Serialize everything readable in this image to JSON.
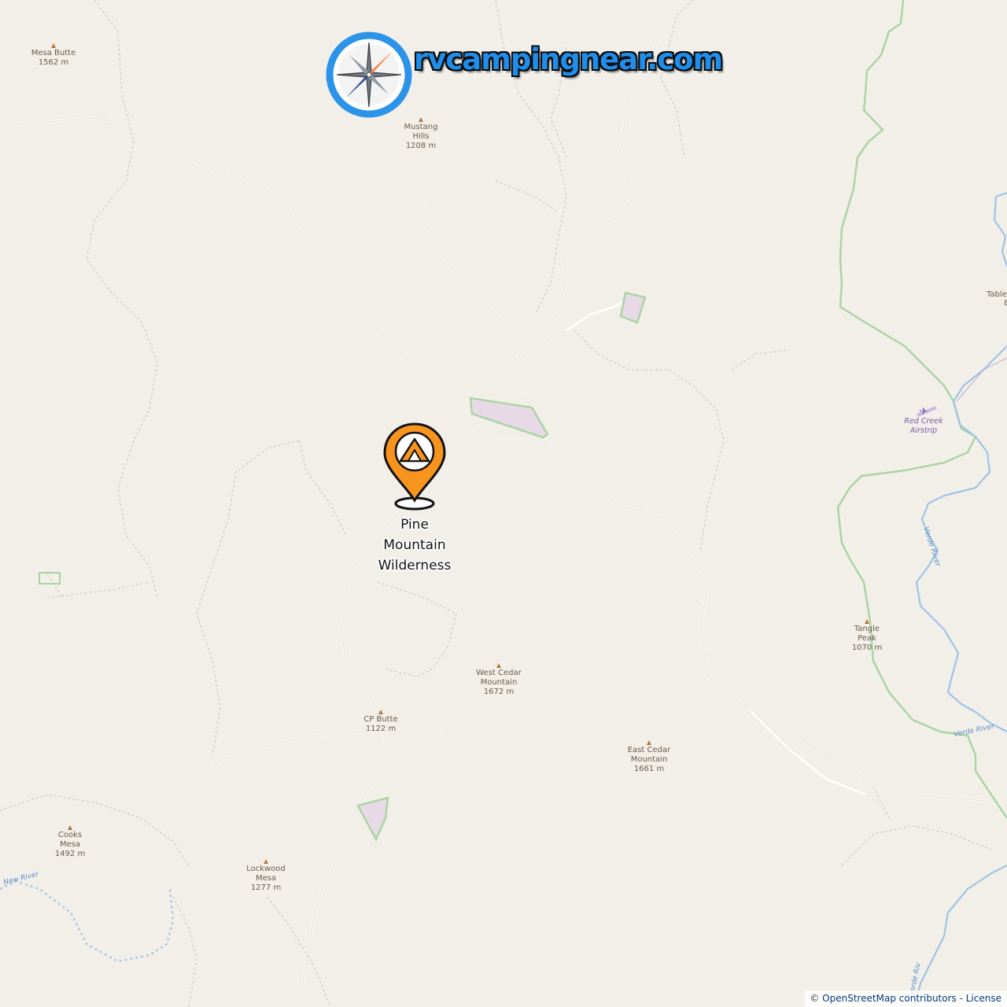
{
  "brand": {
    "site_name": "rvcampingnear.com",
    "logo_icon": "compass-icon"
  },
  "marker": {
    "icon": "tent-icon",
    "color": "#f7941d",
    "label_line1": "Pine",
    "label_line2": "Mountain",
    "label_line3": "Wilderness"
  },
  "peaks": [
    {
      "name_line1": "Mesa Butte",
      "name_line2": "",
      "elevation": "1562 m"
    },
    {
      "name_line1": "Mustang",
      "name_line2": "Hills",
      "elevation": "1208 m"
    },
    {
      "name_line1": "West Cedar",
      "name_line2": "Mountain",
      "elevation": "1672 m"
    },
    {
      "name_line1": "CP Butte",
      "name_line2": "",
      "elevation": "1122 m"
    },
    {
      "name_line1": "East Cedar",
      "name_line2": "Mountain",
      "elevation": "1661 m"
    },
    {
      "name_line1": "Tangle",
      "name_line2": "Peak",
      "elevation": "1070 m"
    },
    {
      "name_line1": "Cooks",
      "name_line2": "Mesa",
      "elevation": "1492 m"
    },
    {
      "name_line1": "Lockwood",
      "name_line2": "Mesa",
      "elevation": "1277 m"
    }
  ],
  "airstrip": {
    "name_line1": "Red Creek",
    "name_line2": "Airstrip",
    "icon": "airplane-icon"
  },
  "rivers": {
    "verde_1": "Verde River",
    "verde_2": "Verde River",
    "verde_3": "Verde Riv",
    "new_river": "New River"
  },
  "edge_label": {
    "text": "Table",
    "partial": "8"
  },
  "attribution": {
    "prefix": "© ",
    "osm": "OpenStreetMap contributors",
    "separator": " - ",
    "license": "License"
  },
  "colors": {
    "land": "#f2efe9",
    "river": "#9fc3e5",
    "boundary": "#9fd19f",
    "track": "#c9bfae",
    "road": "#ffffff",
    "protected_fill": "#e8d9e6"
  }
}
